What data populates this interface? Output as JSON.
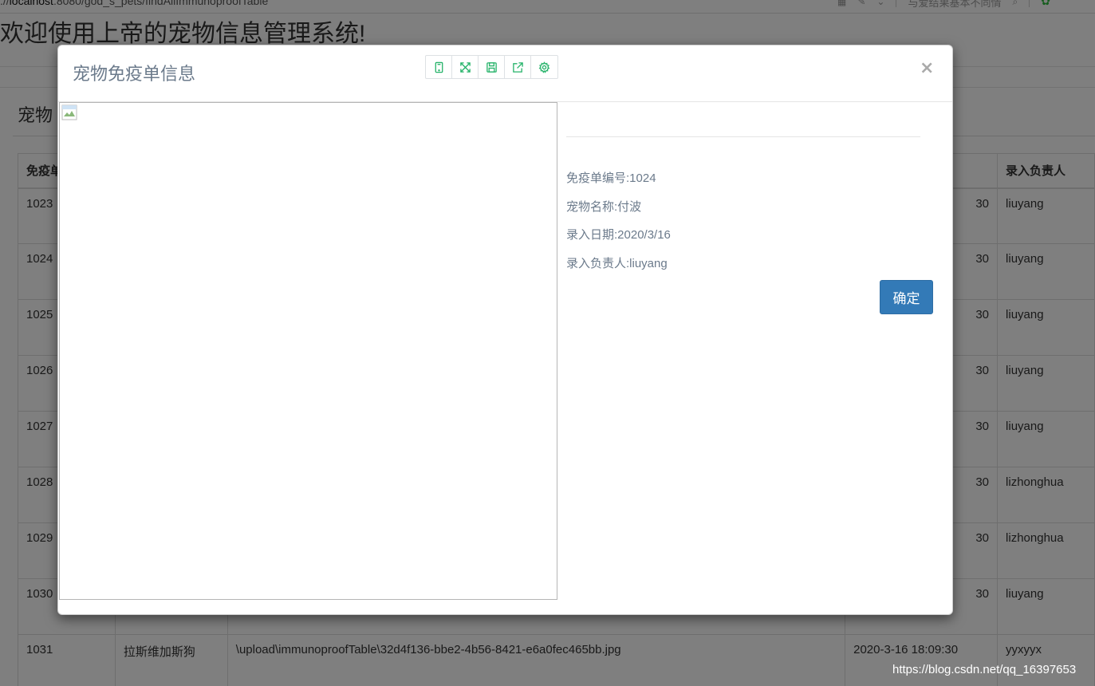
{
  "browser": {
    "url_prefix": "://",
    "url_host": "localhost",
    "url_path": ":8080/god_s_pets/findAllImmunoproofTable",
    "promo_text": "与爱结果基本不同情"
  },
  "page": {
    "title": "欢迎使用上帝的宠物信息管理系统!",
    "panel_title": "宠物",
    "table": {
      "headers": [
        "免疫单",
        "",
        "",
        "",
        "录入负责人"
      ],
      "rows": [
        {
          "id": "1023",
          "name": "",
          "path": "",
          "date": "30",
          "owner": "liuyang"
        },
        {
          "id": "1024",
          "name": "",
          "path": "",
          "date": "30",
          "owner": "liuyang"
        },
        {
          "id": "1025",
          "name": "",
          "path": "",
          "date": "30",
          "owner": "liuyang"
        },
        {
          "id": "1026",
          "name": "",
          "path": "",
          "date": "30",
          "owner": "liuyang"
        },
        {
          "id": "1027",
          "name": "",
          "path": "",
          "date": "30",
          "owner": "liuyang"
        },
        {
          "id": "1028",
          "name": "",
          "path": "",
          "date": "30",
          "owner": "lizhonghua"
        },
        {
          "id": "1029",
          "name": "",
          "path": "",
          "date": "30",
          "owner": "lizhonghua"
        },
        {
          "id": "1030",
          "name": "",
          "path": "",
          "date": "30",
          "owner": "liuyang"
        },
        {
          "id": "1031",
          "name": "拉斯维加斯狗",
          "path": "\\upload\\immunoproofTable\\32d4f136-bbe2-4b56-8421-e6a0fec465bb.jpg",
          "date": "2020-3-16 18:09:30",
          "owner": "yyxyyx"
        }
      ]
    }
  },
  "modal": {
    "title": "宠物免疫单信息",
    "close_glyph": "×",
    "toolbar_icons": [
      "tablet-icon",
      "fullscreen-icon",
      "save-icon",
      "share-icon",
      "settings-icon"
    ],
    "fields": {
      "id": "免疫单编号:1024",
      "pet_name": "宠物名称:付波",
      "date": "录入日期:2020/3/16",
      "owner": "录入负责人:liuyang"
    },
    "ok_label": "确定"
  },
  "watermark": "https://blog.csdn.net/qq_16397653",
  "colors": {
    "primary": "#337ab7",
    "toolbar_icon": "#26b36a",
    "text_muted": "#6b7a8b"
  }
}
